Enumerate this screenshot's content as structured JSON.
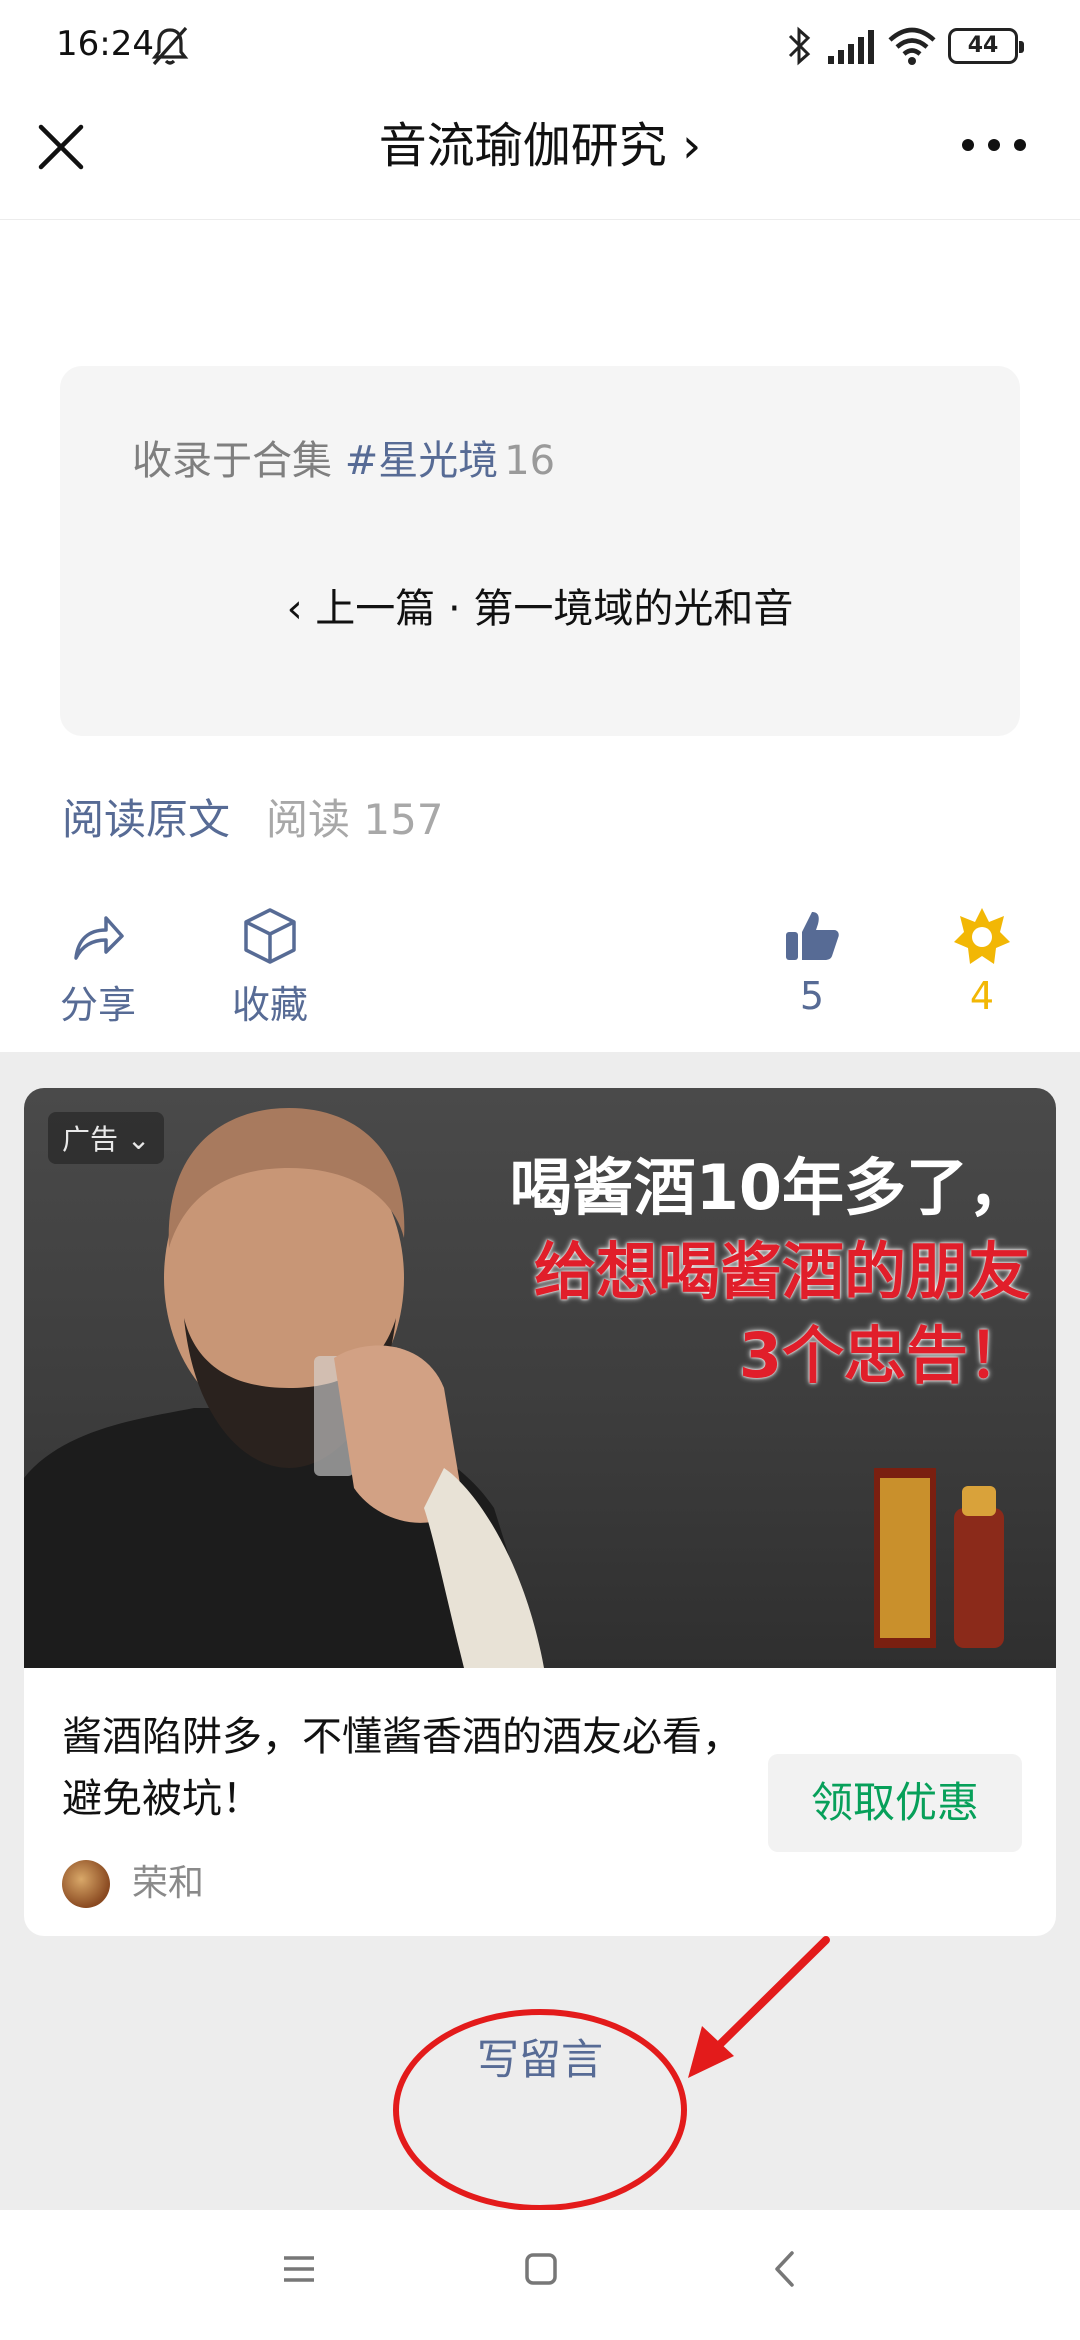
{
  "status_bar": {
    "time": "16:24",
    "battery": "44",
    "icons": [
      "bell-off-icon",
      "bluetooth-icon",
      "signal-icon",
      "wifi-icon",
      "battery-icon"
    ]
  },
  "header": {
    "title": "音流瑜伽研究 ›",
    "icons": [
      "close-icon",
      "chevron-right-icon",
      "more-icon"
    ]
  },
  "collection": {
    "label": "收录于合集",
    "tag": "#星光境",
    "count": "16",
    "prev_article": "‹ 上一篇 · 第一境域的光和音"
  },
  "meta": {
    "read_original": "阅读原文",
    "read_count": "阅读 157"
  },
  "actions": {
    "share_label": "分享",
    "favorite_label": "收藏",
    "like_count": "5",
    "wow_count": "4",
    "colors": {
      "link": "#576b95",
      "wow": "#f2b705"
    }
  },
  "ad": {
    "badge": "广告 ⌄",
    "headline_1": "喝酱酒10年多了，",
    "headline_2": "给想喝酱酒的朋友",
    "headline_3": "3个忠告！",
    "title": "酱酒陷阱多，不懂酱香酒的酒友必看，避免被坑！",
    "cta": "领取优惠",
    "brand": "荣和",
    "colors": {
      "cta": "#07a05a",
      "headline_red": "#e11e2a"
    }
  },
  "comment": {
    "write_label": "写留言",
    "annotation_color": "#e31b1b"
  },
  "nav": {
    "icons": [
      "menu-icon",
      "home-icon",
      "back-icon"
    ]
  }
}
